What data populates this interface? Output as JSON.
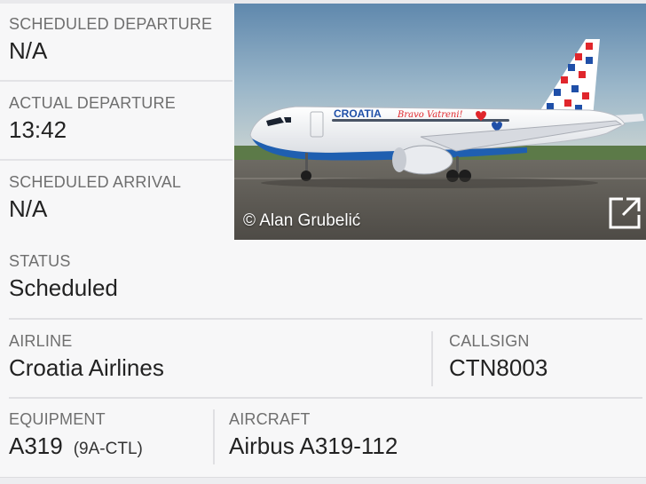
{
  "left_cells": [
    {
      "label": "SCHEDULED DEPARTURE",
      "value": "N/A"
    },
    {
      "label": "ACTUAL DEPARTURE",
      "value": "13:42"
    },
    {
      "label": "SCHEDULED ARRIVAL",
      "value": "N/A"
    }
  ],
  "photo": {
    "credit": "© Alan Grubelić",
    "livery_text": "CROATIA",
    "slogan_text": "Bravo Vatreni!"
  },
  "status": {
    "label": "STATUS",
    "value": "Scheduled"
  },
  "airline": {
    "label": "AIRLINE",
    "value": "Croatia Airlines"
  },
  "callsign": {
    "label": "CALLSIGN",
    "value": "CTN8003"
  },
  "equipment": {
    "label": "EQUIPMENT",
    "value": "A319",
    "registration": "(9A-CTL)"
  },
  "aircraft": {
    "label": "AIRCRAFT",
    "value": "Airbus A319-112"
  },
  "colors": {
    "accent": "#1e6fd9",
    "label": "#6f6f6f",
    "divider": "#e0e0e3"
  }
}
